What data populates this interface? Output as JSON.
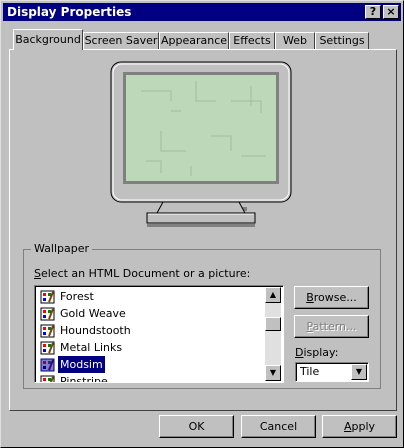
{
  "window": {
    "title": "Display Properties",
    "help_button": "?",
    "close_button": "×"
  },
  "tabs": [
    {
      "label": "Background",
      "active": true
    },
    {
      "label": "Screen Saver",
      "active": false
    },
    {
      "label": "Appearance",
      "active": false
    },
    {
      "label": "Effects",
      "active": false
    },
    {
      "label": "Web",
      "active": false
    },
    {
      "label": "Settings",
      "active": false
    }
  ],
  "preview": {
    "monitor_color": "#c0c0c0",
    "screen_color": "#bcd8b9"
  },
  "wallpaper": {
    "group_label": "Wallpaper",
    "prompt_prefix": "S",
    "prompt_rest": "elect an HTML Document or a picture:",
    "items": [
      {
        "label": "Forest",
        "selected": false,
        "icon": "paint-bitmap-icon"
      },
      {
        "label": "Gold Weave",
        "selected": false,
        "icon": "paint-bitmap-icon"
      },
      {
        "label": "Houndstooth",
        "selected": false,
        "icon": "paint-bitmap-icon"
      },
      {
        "label": "Metal Links",
        "selected": false,
        "icon": "paint-bitmap-icon"
      },
      {
        "label": "Modsim",
        "selected": true,
        "icon": "paint-bitmap-icon"
      },
      {
        "label": "Pinstripe",
        "selected": false,
        "icon": "paint-bitmap-icon"
      }
    ],
    "browse_accel": "B",
    "browse_rest": "rowse...",
    "pattern_accel": "P",
    "pattern_rest": "attern...",
    "display_accel": "D",
    "display_rest": "isplay:",
    "display_value": "Tile"
  },
  "footer": {
    "ok_label": "OK",
    "cancel_label": "Cancel",
    "apply_accel": "A",
    "apply_rest": "pply"
  }
}
